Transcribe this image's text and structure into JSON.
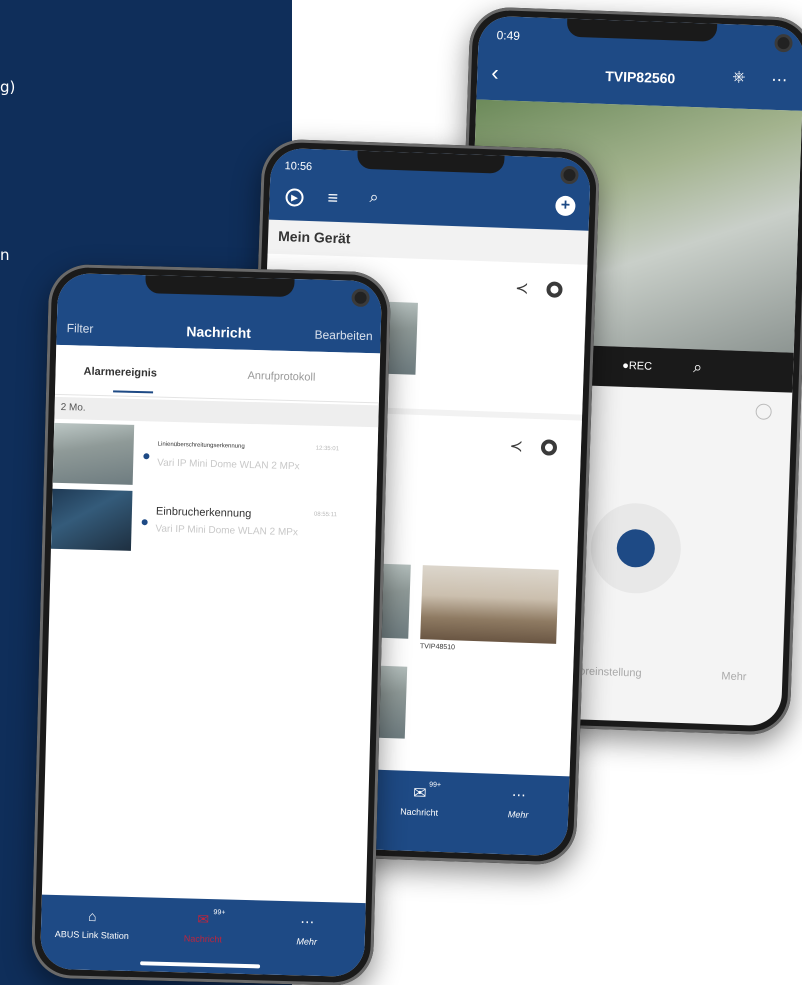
{
  "background": {
    "panel_color": "#0f2e5a",
    "fragments": [
      "g)",
      "n"
    ]
  },
  "phone_back": {
    "status_time": "0:49",
    "title": "TVIP82560",
    "rec_label": "●REC",
    "bottom_tabs": [
      "Voreinstellung",
      "Mehr"
    ]
  },
  "phone_middle": {
    "status_time": "10:56",
    "section_title": "Mein Gerät",
    "device_label": "TVIP48510",
    "bottom_tabs": [
      {
        "label": "Nachricht",
        "badge": "99+"
      },
      {
        "label": "Mehr"
      }
    ]
  },
  "phone_front": {
    "header": {
      "left": "Filter",
      "title": "Nachricht",
      "right": "Bearbeiten"
    },
    "tabs": [
      {
        "label": "Alarmereignis",
        "active": true
      },
      {
        "label": "Anrufprotokoll",
        "active": false
      }
    ],
    "date_header": "2 Mo.",
    "notifications": [
      {
        "title": "Linienüberschreitungserkennung",
        "time": "12:35:01",
        "device": "Vari IP Mini Dome WLAN 2 MPx"
      },
      {
        "title": "Einbrucherkennung",
        "time": "08:55:11",
        "device": "Vari IP Mini Dome WLAN 2 MPx"
      }
    ],
    "bottom_tabs": [
      {
        "label": "ABUS Link Station"
      },
      {
        "label": "Nachricht",
        "badge": "99+",
        "active": true
      },
      {
        "label": "Mehr"
      }
    ]
  },
  "colors": {
    "brand": "#1e4a85",
    "active_tab": "#c0243c"
  }
}
